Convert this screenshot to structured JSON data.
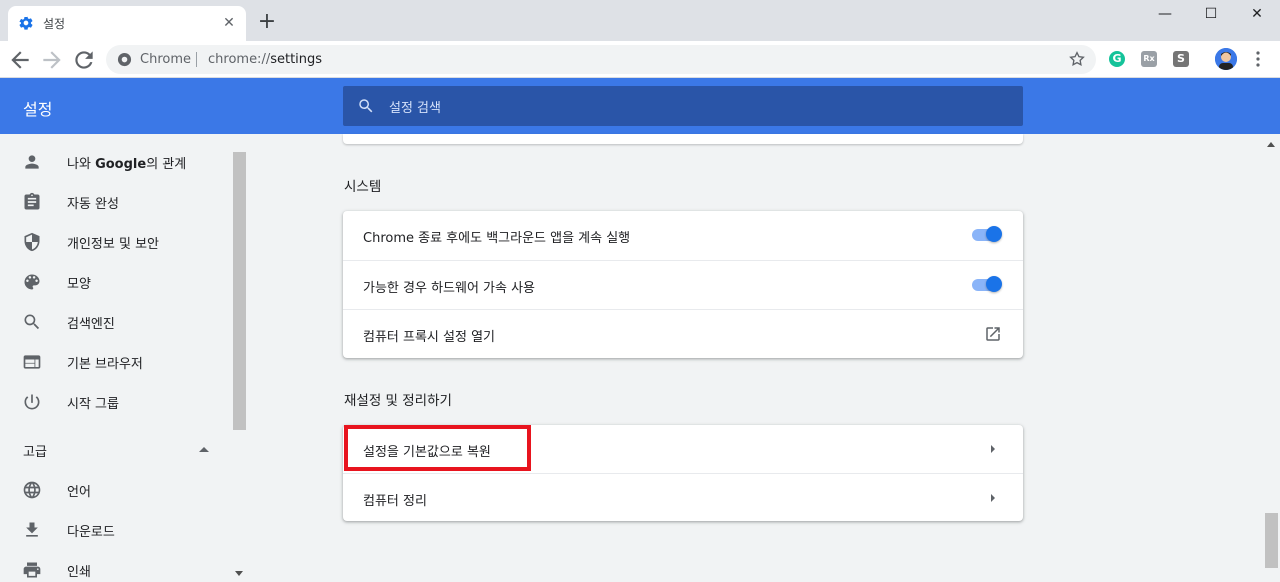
{
  "browser": {
    "tab": {
      "title": "설정",
      "icon": "gear-icon"
    },
    "new_tab_label": "+",
    "window_controls": {
      "minimize": "—",
      "maximize": "☐",
      "close": "✕"
    },
    "omnibox": {
      "site_name": "Chrome",
      "url_scheme": "chrome://",
      "url_path": "settings"
    },
    "extensions": [
      {
        "name": "grammarly-extension-icon",
        "label": "G",
        "color": "#15c39a"
      },
      {
        "name": "rx-extension-icon",
        "label": "Rx",
        "color": "#9aa0a6"
      },
      {
        "name": "s-extension-icon",
        "label": "S",
        "color": "#757575"
      }
    ]
  },
  "header": {
    "title": "설정",
    "search_placeholder": "설정 검색",
    "accent": "#3b78e7"
  },
  "sidebar": {
    "items": [
      {
        "label_bold": "Google",
        "label_prefix": "나와 ",
        "label_suffix": "의 관계",
        "icon": "person-icon"
      },
      {
        "label": "자동 완성",
        "icon": "clipboard-icon"
      },
      {
        "label": "개인정보 및 보안",
        "icon": "shield-icon"
      },
      {
        "label": "모양",
        "icon": "palette-icon"
      },
      {
        "label": "검색엔진",
        "icon": "search-icon"
      },
      {
        "label": "기본 브라우저",
        "icon": "browser-icon"
      },
      {
        "label": "시작 그룹",
        "icon": "power-icon"
      }
    ],
    "advanced_label": "고급",
    "advanced_items": [
      {
        "label": "언어",
        "icon": "globe-icon"
      },
      {
        "label": "다운로드",
        "icon": "download-icon"
      },
      {
        "label": "인쇄",
        "icon": "printer-icon"
      }
    ]
  },
  "main": {
    "system": {
      "title": "시스템",
      "rows": [
        {
          "label": "Chrome 종료 후에도 백그라운드 앱을 계속 실행",
          "control": "toggle",
          "enabled": true
        },
        {
          "label": "가능한 경우 하드웨어 가속 사용",
          "control": "toggle",
          "enabled": true
        },
        {
          "label": "컴퓨터 프록시 설정 열기",
          "control": "external-link"
        }
      ]
    },
    "reset": {
      "title": "재설정 및 정리하기",
      "rows": [
        {
          "label": "설정을 기본값으로 복원",
          "control": "arrow",
          "highlighted": true,
          "highlight_color": "#e8141e"
        },
        {
          "label": "컴퓨터 정리",
          "control": "arrow"
        }
      ]
    }
  }
}
